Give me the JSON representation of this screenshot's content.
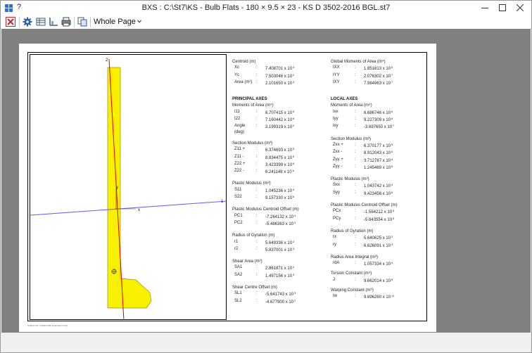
{
  "window": {
    "title": "BXS : C:\\St7\\KS - Bulb Flats - 180 × 9.5 × 23 - KS D 3502-2016 BGL.st7",
    "help_label": "?"
  },
  "toolbar": {
    "zoom_label": "Whole Page"
  },
  "footer": "Strand7 Pro v3 Build 128 [Licensed to N/A]",
  "diagram": {
    "axis_z_label": "2",
    "axis_1_label": "1",
    "y_label": "y",
    "x_label": "x"
  },
  "left_column": [
    {
      "title": "Centroid (m)",
      "rows": [
        {
          "label": "Xc",
          "value": "7.408701",
          "exp": "3"
        },
        {
          "label": "Yc",
          "value": "7.503046",
          "exp": "2"
        },
        {
          "label": "Area (m²)",
          "value": "2.101650",
          "exp": "3"
        }
      ]
    },
    {
      "title": "PRINCIPAL AXES",
      "bold": true,
      "rows": []
    },
    {
      "title": "Moments of Area (m⁴)",
      "rows": [
        {
          "label": "I11",
          "value": "6.707415",
          "exp": "6"
        },
        {
          "label": "I22",
          "value": "7.160442",
          "exp": "8"
        },
        {
          "label": "Angle (deg)",
          "value": "3.199319",
          "exp": "0"
        }
      ]
    },
    {
      "title": "Section Modulus (m³)",
      "rows": [
        {
          "label": "Z11 +",
          "value": "6.374693",
          "exp": "5"
        },
        {
          "label": "Z11 -",
          "value": "8.834475",
          "exp": "5"
        },
        {
          "label": "Z22 +",
          "value": "3.423399",
          "exp": "6"
        },
        {
          "label": "Z22 -",
          "value": "6.241148",
          "exp": "6"
        }
      ]
    },
    {
      "title": "Plastic Modulus (m³)",
      "rows": [
        {
          "label": "S11",
          "value": "1.045236",
          "exp": "4"
        },
        {
          "label": "S22",
          "value": "9.157330",
          "exp": "6"
        }
      ]
    },
    {
      "title": "Plastic Modulus Centroid Offset (m)",
      "rows": [
        {
          "label": "PC1",
          "value": "-7.264132",
          "exp": "4"
        },
        {
          "label": "PC2",
          "value": "-5.486363",
          "exp": "3"
        }
      ]
    },
    {
      "title": "Radius of Gyration (m)",
      "rows": [
        {
          "label": "r1",
          "value": "5.649336",
          "exp": "2"
        },
        {
          "label": "r2",
          "value": "5.837001",
          "exp": "3"
        }
      ]
    },
    {
      "title": "Shear Area (m²)",
      "rows": [
        {
          "label": "SA1",
          "value": "2.861871",
          "exp": "4"
        },
        {
          "label": "SA2",
          "value": "1.497156",
          "exp": "3"
        }
      ]
    },
    {
      "title": "Shear Centre Offset (m)",
      "rows": [
        {
          "label": "SL1",
          "value": "-5.641743",
          "exp": "3"
        },
        {
          "label": "SL2",
          "value": "-4.677900",
          "exp": "2"
        }
      ]
    }
  ],
  "right_column": [
    {
      "title": "Global Moments of Area (m⁴)",
      "rows": [
        {
          "label": "IXX",
          "value": "1.851813",
          "exp": "5"
        },
        {
          "label": "IYY",
          "value": "2.076302",
          "exp": "7"
        },
        {
          "label": "IXY",
          "value": "7.984963",
          "exp": "7"
        }
      ]
    },
    {
      "title": "LOCAL AXES",
      "bold": true,
      "rows": []
    },
    {
      "title": "Moments of Area (m⁴)",
      "rows": [
        {
          "label": "Ixx",
          "value": "6.686746",
          "exp": "6"
        },
        {
          "label": "Iyy",
          "value": "9.227309",
          "exp": "8"
        },
        {
          "label": "Ixy",
          "value": "-3.697650",
          "exp": "7"
        }
      ]
    },
    {
      "title": "Section Modulus (m³)",
      "rows": [
        {
          "label": "Zxx +",
          "value": "6.370177",
          "exp": "5"
        },
        {
          "label": "Zxx -",
          "value": "8.912043",
          "exp": "5"
        },
        {
          "label": "Zyy +",
          "value": "3.712787",
          "exp": "6"
        },
        {
          "label": "Zyy -",
          "value": "1.245469",
          "exp": "5"
        }
      ]
    },
    {
      "title": "Plastic Modulus (m³)",
      "rows": [
        {
          "label": "Sxx",
          "value": "1.043742",
          "exp": "4"
        },
        {
          "label": "Syy",
          "value": "9.423456",
          "exp": "6"
        }
      ]
    },
    {
      "title": "Plastic Modulus Centroid Offset (m)",
      "rows": [
        {
          "label": "PCx",
          "value": "-1.564212",
          "exp": "3"
        },
        {
          "label": "PCy",
          "value": "-5.643554",
          "exp": "3"
        }
      ]
    },
    {
      "title": "Radius of Gyration (m)",
      "rows": [
        {
          "label": "rx",
          "value": "5.640625",
          "exp": "2"
        },
        {
          "label": "ry",
          "value": "6.626091",
          "exp": "3"
        }
      ]
    },
    {
      "title": "Radius Area Integral (m³)",
      "rows": [
        {
          "label": "rdA",
          "value": "1.057334",
          "exp": "4"
        }
      ]
    },
    {
      "title": "Torsion Constant (m⁴)",
      "rows": [
        {
          "label": "J",
          "value": "9.662014",
          "exp": "8"
        }
      ]
    },
    {
      "title": "Warping Constant (m⁶)",
      "rows": [
        {
          "label": "Iw",
          "value": "9.696260",
          "exp": "11"
        }
      ]
    }
  ],
  "colors": {
    "section_fill": "#f7f000",
    "axis_principal": "#e00000",
    "axis_horizontal": "#5a5aff"
  }
}
